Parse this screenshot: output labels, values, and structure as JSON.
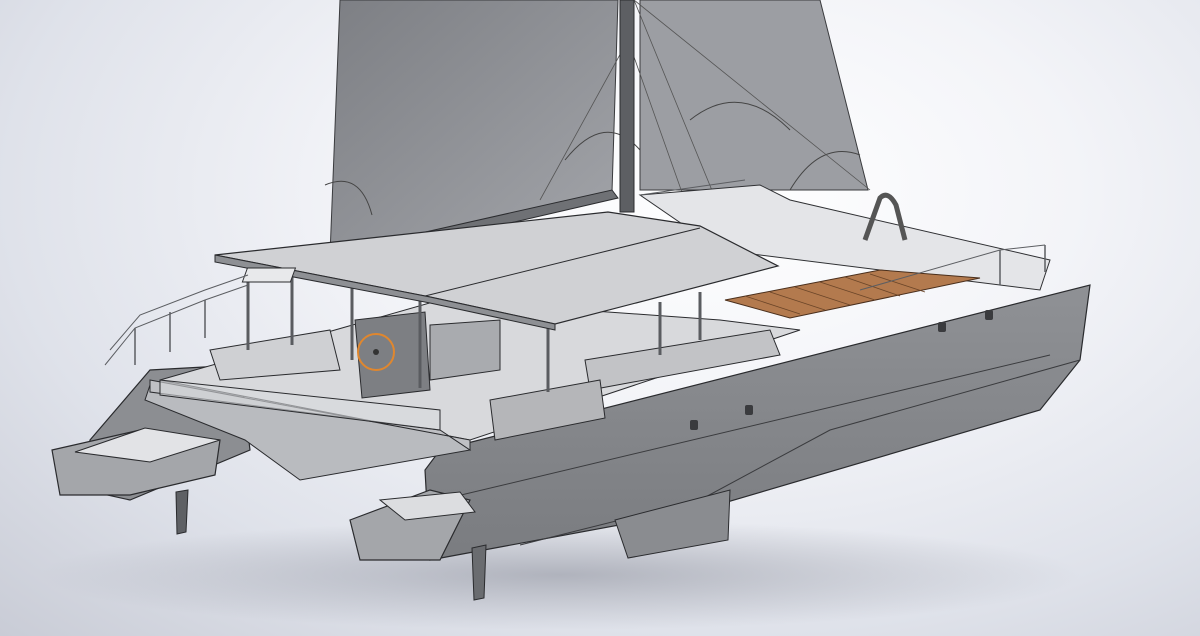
{
  "scene": {
    "subject": "catamaran-3d-cad-model",
    "view": "isometric-rear-quarter",
    "colors": {
      "background_light": "#f4f5f9",
      "background_shadow": "#c9ccd6",
      "hull": "#8d8f93",
      "hull_dark": "#6d6f73",
      "deck": "#d2d3d6",
      "hardtop": "#c6c7ca",
      "sail": "#8a8c91",
      "mast": "#5a5c60",
      "teak_deck": "#b37a4e",
      "helm_highlight": "#e0872e",
      "edge_line": "#2a2b2e"
    }
  }
}
